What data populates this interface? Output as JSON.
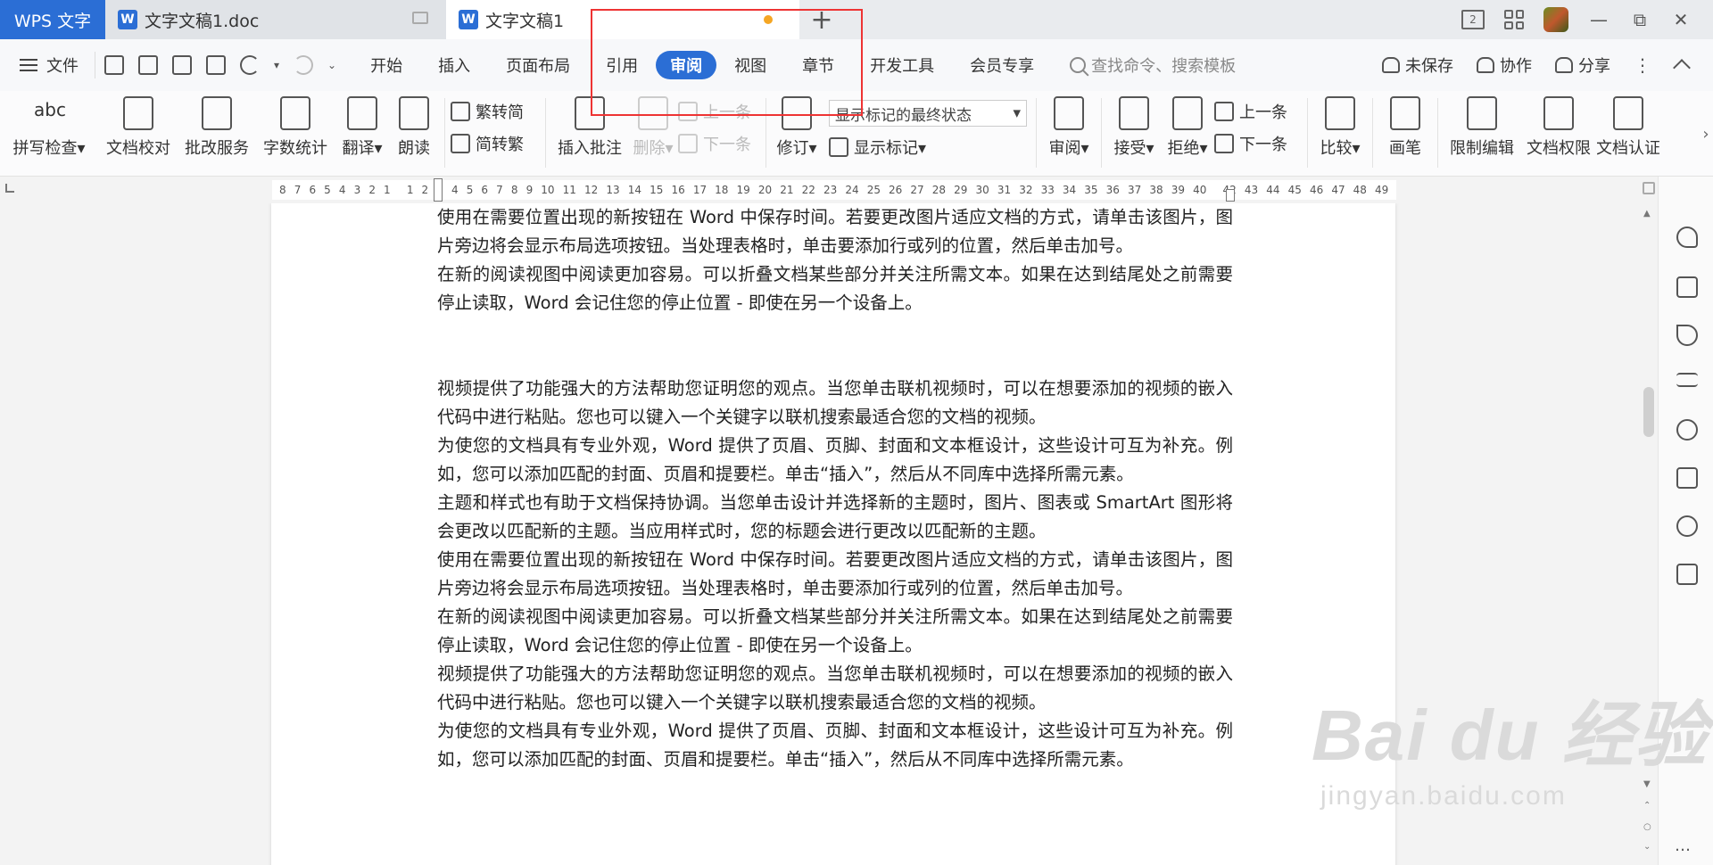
{
  "titlebar": {
    "app_tab": "WPS 文字",
    "tabs": [
      {
        "label": "文字文稿1.doc",
        "icon": "W"
      },
      {
        "label": "文字文稿1",
        "icon": "W"
      }
    ],
    "new_tab": "+",
    "page_count": "2"
  },
  "menubar": {
    "file": "文件",
    "tabs": [
      "开始",
      "插入",
      "页面布局",
      "引用",
      "审阅",
      "视图",
      "章节",
      "开发工具",
      "会员专享"
    ],
    "active_tab": "审阅",
    "search_placeholder": "查找命令、搜索模板",
    "unsaved": "未保存",
    "collaborate": "协作",
    "share": "分享",
    "more": "⋮"
  },
  "ribbon": {
    "spell_check": "拼写检查",
    "spell_icon_text": "abc",
    "proofread": "文档校对",
    "review_service": "批改服务",
    "word_count": "字数统计",
    "translate": "翻译",
    "read_aloud": "朗读",
    "trad_to_simp": "繁转简",
    "simp_to_trad": "简转繁",
    "insert_comment": "插入批注",
    "delete": "删除",
    "prev_comment": "上一条",
    "next_comment": "下一条",
    "track_changes": "修订",
    "markup_view": "显示标记的最终状态",
    "show_markup": "显示标记",
    "review_pane": "审阅",
    "accept": "接受",
    "reject": "拒绝",
    "prev_change": "上一条",
    "next_change": "下一条",
    "compare": "比较",
    "pen": "画笔",
    "restrict_edit": "限制编辑",
    "doc_permission": "文档权限",
    "doc_cert": "文档认证"
  },
  "ruler": {
    "ticks": [
      "8",
      "7",
      "6",
      "5",
      "4",
      "3",
      "2",
      "1",
      "",
      "1",
      "2",
      "3",
      "4",
      "5",
      "6",
      "7",
      "8",
      "9",
      "10",
      "11",
      "12",
      "13",
      "14",
      "15",
      "16",
      "17",
      "18",
      "19",
      "20",
      "21",
      "22",
      "23",
      "24",
      "25",
      "26",
      "27",
      "28",
      "29",
      "30",
      "31",
      "32",
      "33",
      "34",
      "35",
      "36",
      "37",
      "38",
      "39",
      "40",
      "",
      "42",
      "43",
      "44",
      "45",
      "46",
      "47",
      "48",
      "49"
    ]
  },
  "document": {
    "paragraphs_top": [
      "使用在需要位置出现的新按钮在 Word 中保存时间。若要更改图片适应文档的方式，请单击该图片，图片旁边将会显示布局选项按钮。当处理表格时，单击要添加行或列的位置，然后单击加号。",
      "在新的阅读视图中阅读更加容易。可以折叠文档某些部分并关注所需文本。如果在达到结尾处之前需要停止读取，Word 会记住您的停止位置 - 即使在另一个设备上。"
    ],
    "paragraphs_bottom": [
      "视频提供了功能强大的方法帮助您证明您的观点。当您单击联机视频时，可以在想要添加的视频的嵌入代码中进行粘贴。您也可以键入一个关键字以联机搜索最适合您的文档的视频。",
      "为使您的文档具有专业外观，Word 提供了页眉、页脚、封面和文本框设计，这些设计可互为补充。例如，您可以添加匹配的封面、页眉和提要栏。单击“插入”，然后从不同库中选择所需元素。",
      "主题和样式也有助于文档保持协调。当您单击设计并选择新的主题时，图片、图表或 SmartArt 图形将会更改以匹配新的主题。当应用样式时，您的标题会进行更改以匹配新的主题。",
      "使用在需要位置出现的新按钮在 Word 中保存时间。若要更改图片适应文档的方式，请单击该图片，图片旁边将会显示布局选项按钮。当处理表格时，单击要添加行或列的位置，然后单击加号。",
      "在新的阅读视图中阅读更加容易。可以折叠文档某些部分并关注所需文本。如果在达到结尾处之前需要停止读取，Word 会记住您的停止位置 - 即使在另一个设备上。",
      "视频提供了功能强大的方法帮助您证明您的观点。当您单击联机视频时，可以在想要添加的视频的嵌入代码中进行粘贴。您也可以键入一个关键字以联机搜索最适合您的文档的视频。",
      "为使您的文档具有专业外观，Word 提供了页眉、页脚、封面和文本框设计，这些设计可互为补充。例如，您可以添加匹配的封面、页眉和提要栏。单击“插入”，然后从不同库中选择所需元素。"
    ]
  },
  "watermark": {
    "main": "Bai du 经验",
    "sub": "jingyan.baidu.com"
  },
  "colors": {
    "accent": "#2b6ed5",
    "highlight_box": "#e33333",
    "unsaved_dot": "#f5a623"
  }
}
